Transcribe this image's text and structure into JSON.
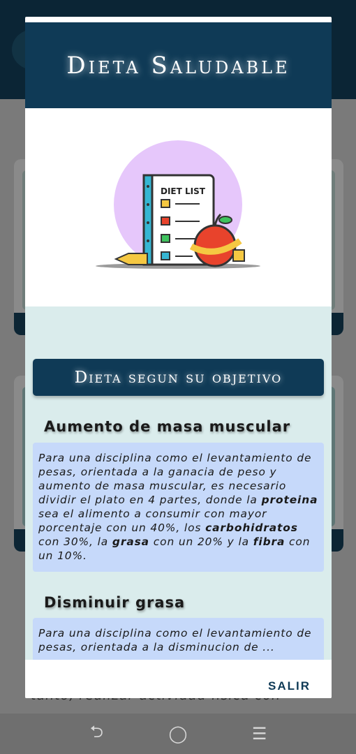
{
  "dialog": {
    "title": "Dieta Saludable",
    "illustration": {
      "label": "DIET LIST",
      "colors": {
        "circle": "#e6c7fb",
        "board": "#ffffff",
        "border": "#333333",
        "apple": "#e8432c",
        "tape": "#f5c842"
      }
    },
    "section_banner": "Dieta segun su objetivo",
    "topics": [
      {
        "heading": "Aumento de masa muscular",
        "text_segments": [
          {
            "text": "Para una disciplina como el levantamiento de pesas, orientada a la ganacia de peso y aumento de masa muscular, es necesario dividir el plato en 4 partes, donde la ",
            "bold": false
          },
          {
            "text": "proteina",
            "bold": true
          },
          {
            "text": " sea el alimento a consumir con mayor porcentaje con un 40%, los ",
            "bold": false
          },
          {
            "text": "carbohidratos",
            "bold": true
          },
          {
            "text": " con 30%, la ",
            "bold": false
          },
          {
            "text": "grasa",
            "bold": true
          },
          {
            "text": " con un 20% y la ",
            "bold": false
          },
          {
            "text": "fibra",
            "bold": true
          },
          {
            "text": " con un 10%.",
            "bold": false
          }
        ]
      },
      {
        "heading": "Disminuir grasa",
        "text_segments": [
          {
            "text": "Para una disciplina como el levantamiento de pesas, orientada a la disminucion de ...",
            "bold": false
          }
        ]
      }
    ],
    "footer": {
      "exit_label": "SALIR"
    }
  },
  "background": {
    "ghost_text": "tanto, realizar actividad fisica con"
  },
  "navbar": {
    "back_glyph": "⮌",
    "home_glyph": "◯",
    "menu_glyph": "☰"
  },
  "colors": {
    "primary": "#0f3a56",
    "panel_bg": "#daecec",
    "topic_box": "#c6d9fa"
  }
}
